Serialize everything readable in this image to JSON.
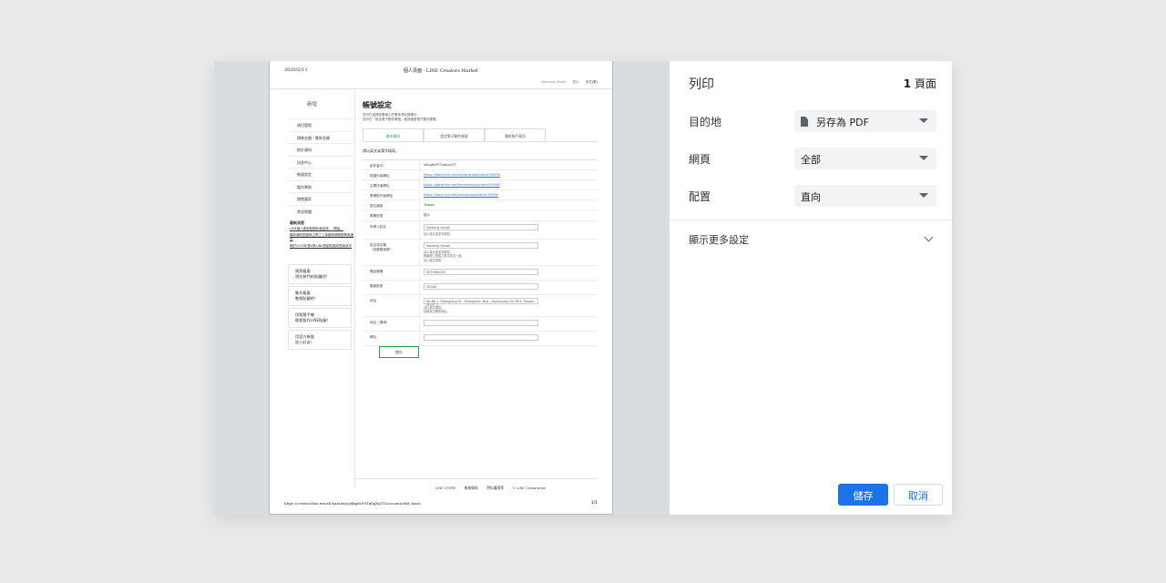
{
  "preview": {
    "header_date": "2020/2/11",
    "header_title": "個人頁面 - LINE Creators Market",
    "top_links": [
      "Yaoheng Hsueh",
      "登出",
      "中文(繁)"
    ],
    "side_title": "新增",
    "side_menu": [
      "項目管理",
      "銷售金額／匯款金額",
      "統計資料",
      "訊息中心",
      "帳號設定",
      "製作準則",
      "銷售國家",
      "常見問題"
    ],
    "news_heading": "最新消息",
    "news_items": [
      "LINE個人原創貼圖年度結算 ... 開始。",
      "最新通知貼圖與主題之上架審核期間服務與通知",
      "關於2019年第4季LINE原創貼圖成長與狀況"
    ],
    "promo_boxes": [
      "實際看看\n現在熱門的貼圖吧！",
      "動作看看\n動態貼圖吧！",
      "用智慧手機\n輕鬆製作LINE貼圖！",
      "用官方帳號\n加入好友！"
    ],
    "main_title": "帳號設定",
    "main_desc": "您可在這裡查看個人的基本資料與帳戶。\n您可在「設定電子郵件帳號」更改變更電子郵件帳號。",
    "tabs": [
      "基本資訊",
      "設定電子郵件帳號",
      "匯款帳戶資訊"
    ],
    "required_note": "請以英文或漢字填寫。",
    "rows": [
      {
        "k": "創作者ID",
        "v": "a8kg6cP5TxbqXyZT"
      },
      {
        "k": "貼圖作者網址",
        "link": "https://store.line.me/stickershop/author/95096"
      },
      {
        "k": "主題作者網址",
        "link": "https://store.line.me/themeshop/author/95096"
      },
      {
        "k": "表情貼作者網址",
        "link": "https://store.line.me/emojishop/author/95096"
      },
      {
        "k": "居住國家",
        "v": "Taiwan"
      },
      {
        "k": "專業型態",
        "v": "個人"
      },
      {
        "k": "申請人姓名",
        "input": "Yaoheng Hsueh",
        "note": "請以英文或漢字填寫。"
      },
      {
        "k": "姓名或名稱\n（依護照填寫）",
        "input": "Yaoheng Hsueh",
        "note": "請以英文或漢字填寫。\n與護照上登載之英文姓名一致。\n請以英文填寫。"
      },
      {
        "k": "電話號碼",
        "input": "0970962035"
      },
      {
        "k": "郵遞區號",
        "input": "20046"
      },
      {
        "k": "地址",
        "input": "No.88-1, Zhongping St., Zhongshan Dist., Kaohsiung City 803, Taiwan (R.O.C.)",
        "note": "請以英文填寫。\n請填寫正確的地址。"
      },
      {
        "k": "地址（選填）",
        "input": ""
      },
      {
        "k": "網址",
        "input": ""
      }
    ],
    "save_label": "儲存",
    "footer_links": [
      "LINE STORE",
      "服務條款",
      "隱私權政策",
      "© LINE Corporation"
    ],
    "url": "https://creator.line.me/zh-hant/my/a8kg6cP5TxbqXyZT/account/edit_basic",
    "page_num": "1/1"
  },
  "panel": {
    "title": "列印",
    "pages_count": "1",
    "pages_unit": "頁面",
    "destination_label": "目的地",
    "destination_value": "另存為 PDF",
    "pages_label": "網頁",
    "pages_value": "全部",
    "layout_label": "配置",
    "layout_value": "直向",
    "more_settings": "顯示更多設定",
    "save": "儲存",
    "cancel": "取消",
    "accent": "#1a73e8"
  }
}
